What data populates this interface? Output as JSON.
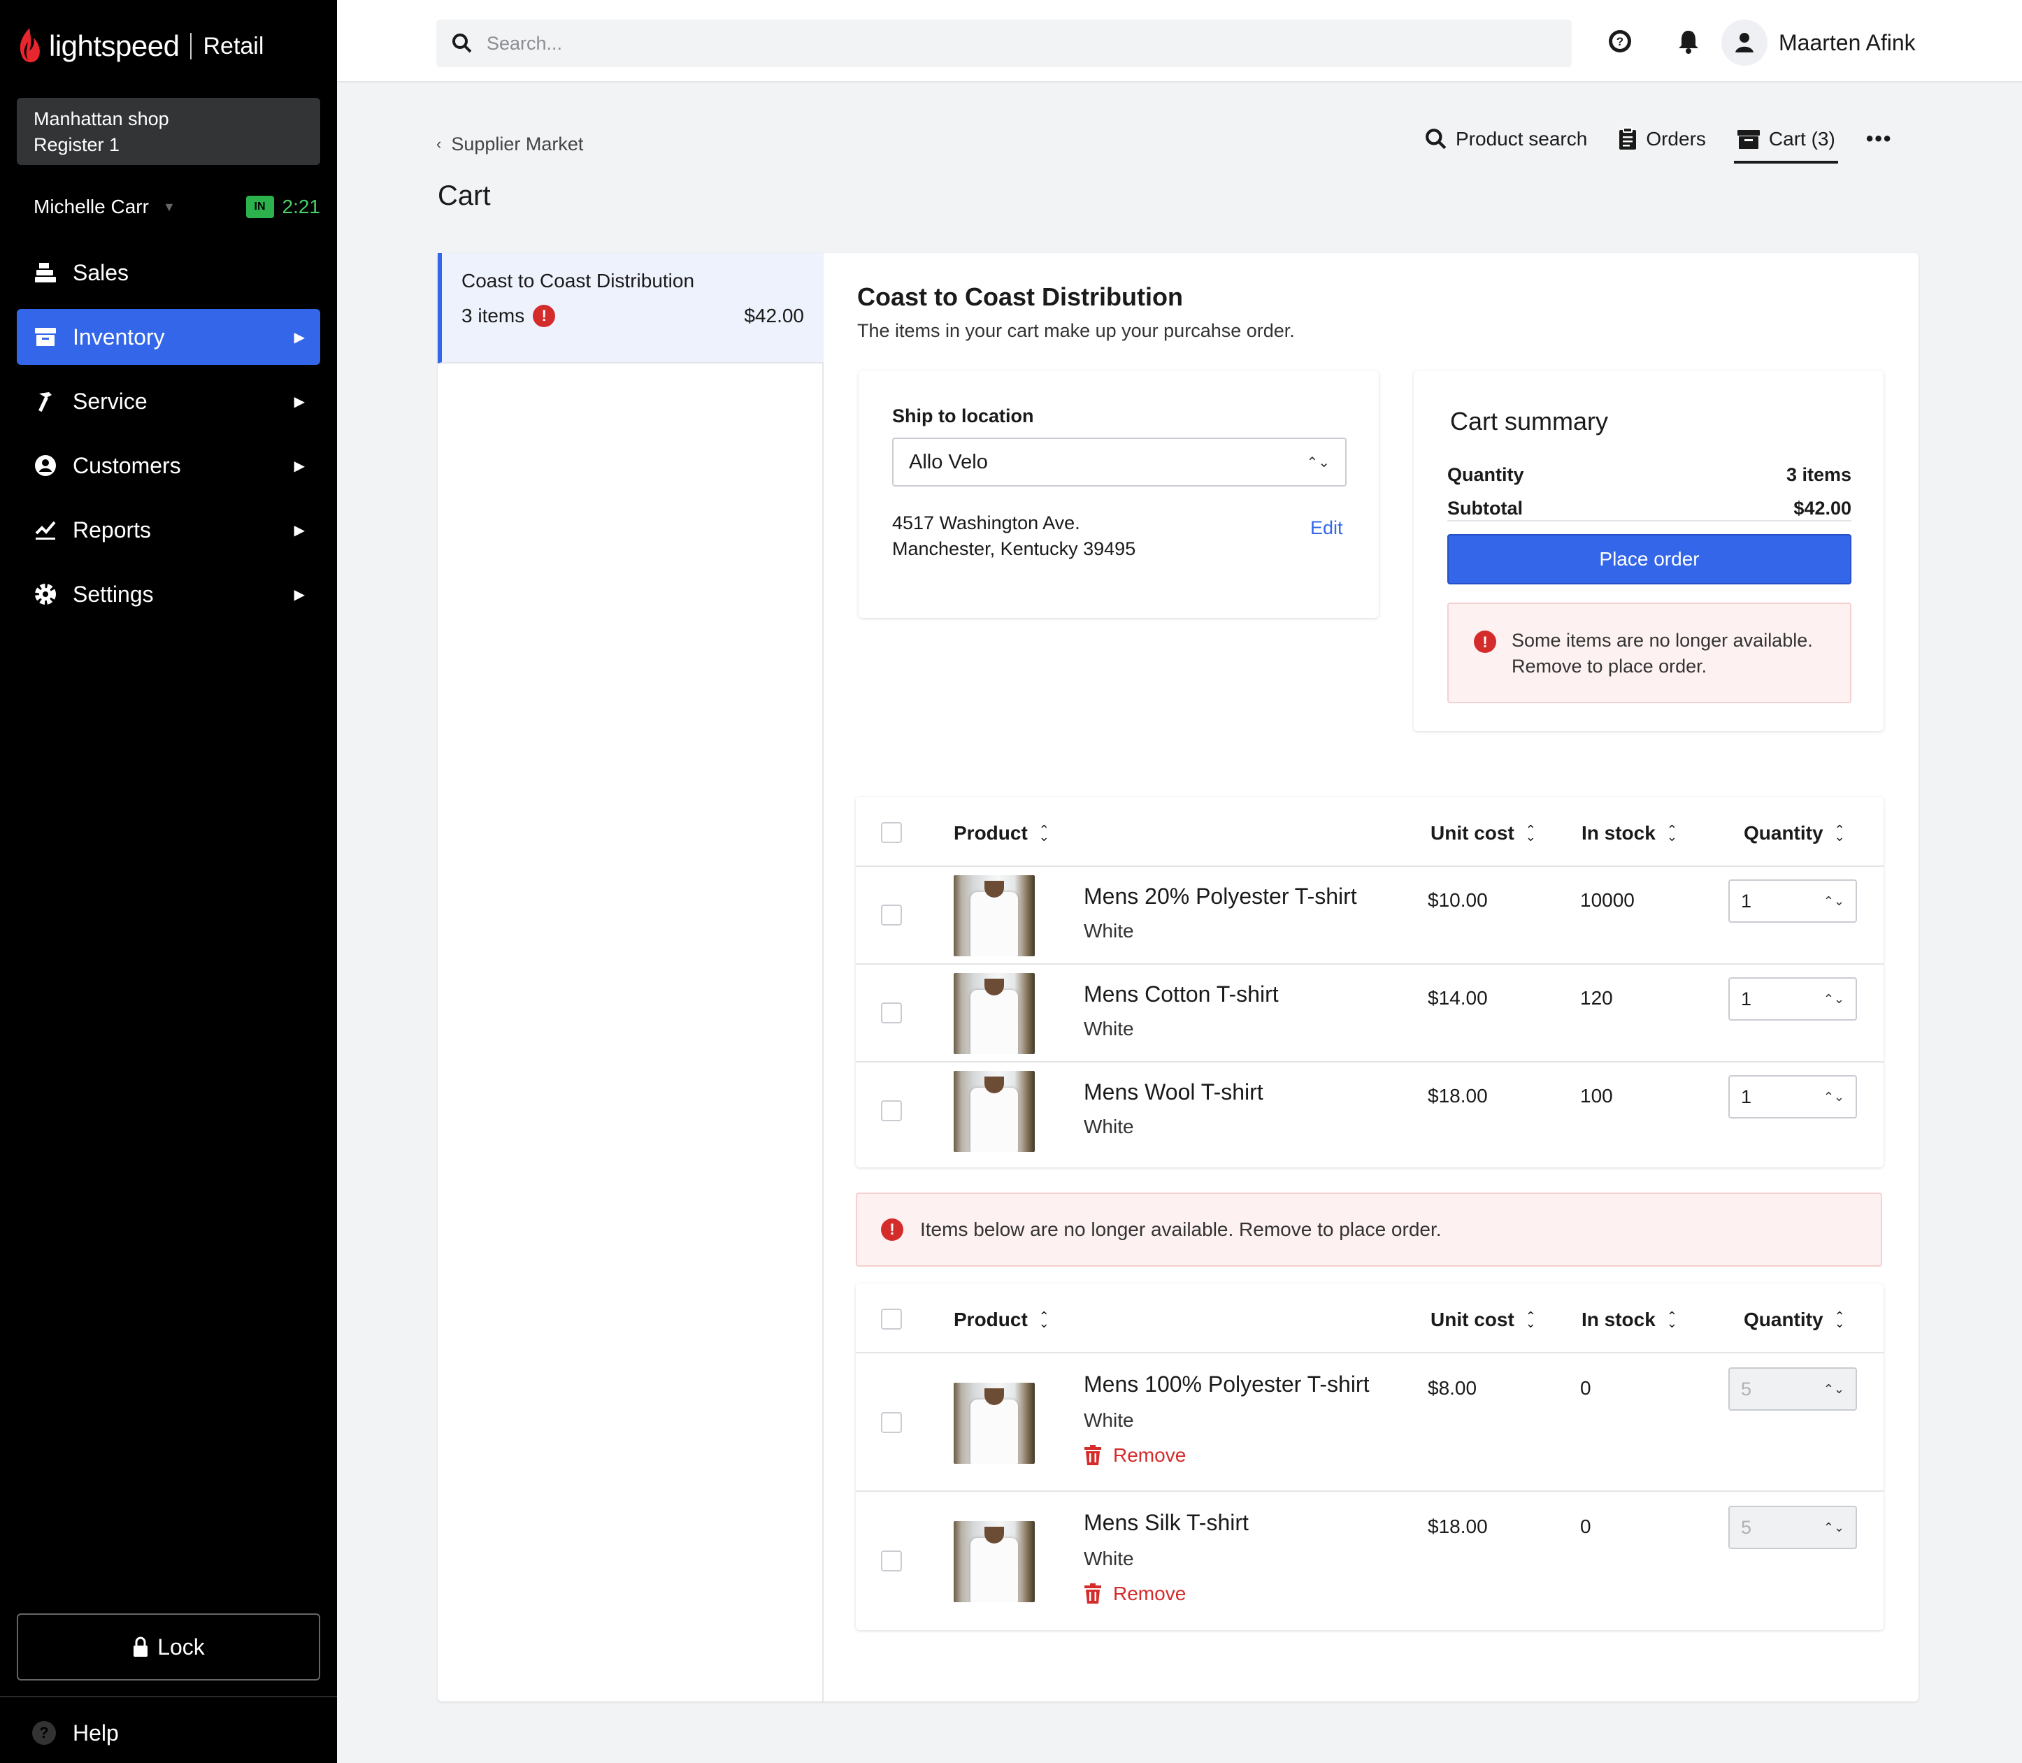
{
  "brand": {
    "name": "lightspeed",
    "product": "Retail"
  },
  "shop": {
    "name": "Manhattan shop",
    "register": "Register 1"
  },
  "user": {
    "name": "Michelle Carr",
    "status": "IN",
    "time": "2:21"
  },
  "nav": [
    {
      "label": "Sales",
      "icon": "register-icon"
    },
    {
      "label": "Inventory",
      "icon": "inventory-icon",
      "active": true
    },
    {
      "label": "Service",
      "icon": "hammer-icon"
    },
    {
      "label": "Customers",
      "icon": "user-circle-icon"
    },
    {
      "label": "Reports",
      "icon": "chart-icon"
    },
    {
      "label": "Settings",
      "icon": "gear-icon"
    }
  ],
  "lock_label": "Lock",
  "help_label": "Help",
  "search": {
    "placeholder": "Search..."
  },
  "profile": {
    "name": "Maarten Afink"
  },
  "breadcrumb": "Supplier Market",
  "page_title": "Cart",
  "tabs": [
    {
      "label": "Product search",
      "icon": "search-icon"
    },
    {
      "label": "Orders",
      "icon": "clipboard-icon"
    },
    {
      "label": "Cart (3)",
      "icon": "cart-box-icon",
      "active": true
    }
  ],
  "supplier_list": [
    {
      "name": "Coast to Coast Distribution",
      "items": "3 items",
      "total": "$42.00",
      "has_error": true
    }
  ],
  "detail": {
    "title": "Coast to Coast Distribution",
    "subtitle": "The items in your cart make up your purcahse order."
  },
  "ship": {
    "label": "Ship to location",
    "selected": "Allo Velo",
    "address_line1": "4517 Washington Ave.",
    "address_line2": "Manchester, Kentucky 39495",
    "edit_label": "Edit"
  },
  "summary": {
    "title": "Cart summary",
    "quantity_label": "Quantity",
    "quantity_value": "3 items",
    "subtotal_label": "Subtotal",
    "subtotal_value": "$42.00",
    "place_order_label": "Place order",
    "alert_line1": "Some items are no longer available.",
    "alert_line2": "Remove to place order."
  },
  "table_headers": {
    "product": "Product",
    "unit_cost": "Unit cost",
    "in_stock": "In stock",
    "quantity": "Quantity"
  },
  "available_items": [
    {
      "name": "Mens 20% Polyester T-shirt",
      "variant": "White",
      "unit_cost": "$10.00",
      "in_stock": "10000",
      "quantity": "1"
    },
    {
      "name": "Mens Cotton T-shirt",
      "variant": "White",
      "unit_cost": "$14.00",
      "in_stock": "120",
      "quantity": "1"
    },
    {
      "name": "Mens Wool T-shirt",
      "variant": "White",
      "unit_cost": "$18.00",
      "in_stock": "100",
      "quantity": "1"
    }
  ],
  "unavailable_alert": "Items below are no longer available. Remove to place order.",
  "unavailable_items": [
    {
      "name": "Mens 100% Polyester T-shirt",
      "variant": "White",
      "unit_cost": "$8.00",
      "in_stock": "0",
      "quantity": "5",
      "remove_label": "Remove"
    },
    {
      "name": "Mens Silk T-shirt",
      "variant": "White",
      "unit_cost": "$18.00",
      "in_stock": "0",
      "quantity": "5",
      "remove_label": "Remove"
    }
  ],
  "colors": {
    "accent": "#3366e8",
    "error": "#d42b2b",
    "sidebar": "#000000",
    "success": "#2bb24c"
  }
}
